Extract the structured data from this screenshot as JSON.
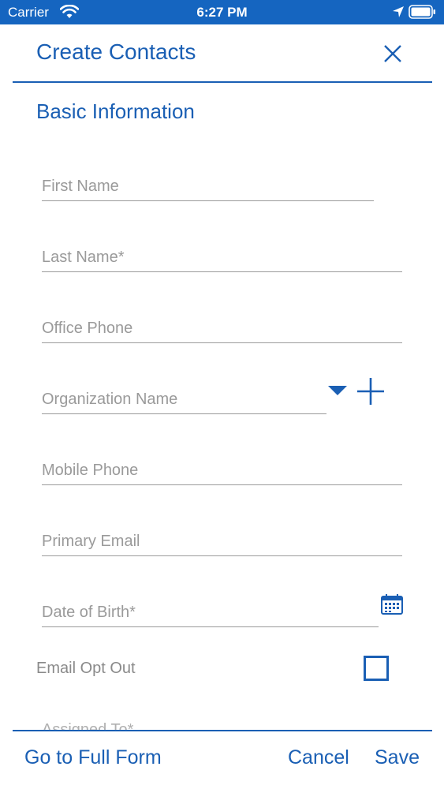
{
  "status_bar": {
    "carrier": "Carrier",
    "time": "6:27 PM",
    "icons": [
      "wifi-icon",
      "location-arrow-icon",
      "battery-icon"
    ]
  },
  "header": {
    "title": "Create Contacts",
    "close_icon": "close-icon"
  },
  "section": {
    "title": "Basic Information"
  },
  "fields": {
    "first_name": {
      "placeholder": "First Name",
      "value": ""
    },
    "last_name": {
      "placeholder": "Last Name*",
      "value": ""
    },
    "office_phone": {
      "placeholder": "Office Phone",
      "value": ""
    },
    "organization_name": {
      "placeholder": "Organization Name",
      "value": ""
    },
    "mobile_phone": {
      "placeholder": "Mobile Phone",
      "value": ""
    },
    "primary_email": {
      "placeholder": "Primary Email",
      "value": ""
    },
    "date_of_birth": {
      "placeholder": "Date of Birth*",
      "value": ""
    },
    "email_opt_out": {
      "label": "Email Opt Out",
      "checked": false
    },
    "assigned_to": {
      "label": "Assigned To*"
    }
  },
  "footer": {
    "full_form_label": "Go to Full Form",
    "cancel_label": "Cancel",
    "save_label": "Save"
  },
  "colors": {
    "accent": "#1a5fb4",
    "status_bar": "#1565c0",
    "placeholder": "#9a9a9a"
  }
}
